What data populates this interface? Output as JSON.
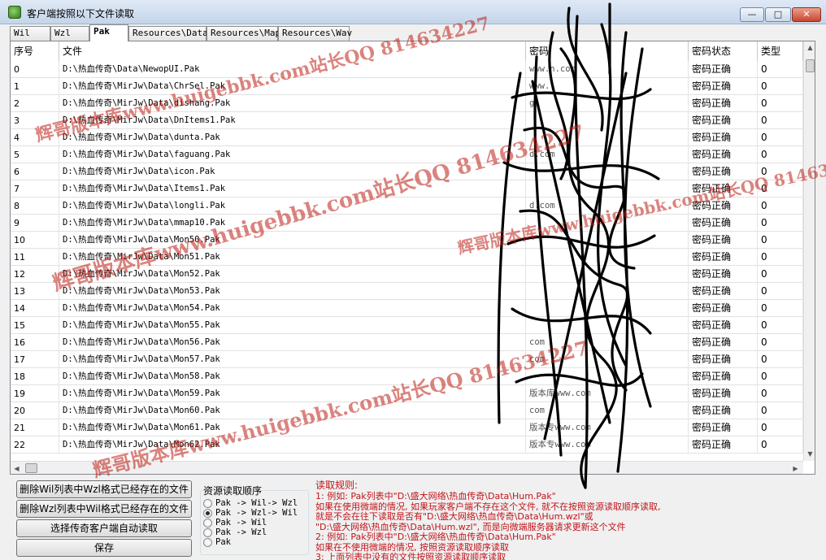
{
  "window": {
    "title": "客户端按照以下文件读取",
    "min_label": "—",
    "max_label": "□",
    "close_label": "✕"
  },
  "tabs": [
    {
      "label": "Wil"
    },
    {
      "label": "Wzl"
    },
    {
      "label": "Pak"
    },
    {
      "label": "Resources\\Data"
    },
    {
      "label": "Resources\\Map"
    },
    {
      "label": "Resources\\Wav"
    }
  ],
  "grid": {
    "columns": [
      "序号",
      "文件",
      "密码",
      "密码状态",
      "类型"
    ],
    "rows": [
      {
        "index": "0",
        "file": "D:\\热血传奇\\Data\\NewopUI.Pak",
        "password": "www.n.com",
        "status": "密码正确",
        "type": "0"
      },
      {
        "index": "1",
        "file": "D:\\热血传奇\\MirJw\\Data\\ChrSel.Pak",
        "password": "www.",
        "status": "密码正确",
        "type": "0"
      },
      {
        "index": "2",
        "file": "D:\\热血传奇\\MirJw\\Data\\dishang.Pak",
        "password": "g",
        "status": "密码正确",
        "type": "0"
      },
      {
        "index": "3",
        "file": "D:\\热血传奇\\MirJw\\Data\\DnItems1.Pak",
        "password": "",
        "status": "密码正确",
        "type": "0"
      },
      {
        "index": "4",
        "file": "D:\\热血传奇\\MirJw\\Data\\dunta.Pak",
        "password": "",
        "status": "密码正确",
        "type": "0"
      },
      {
        "index": "5",
        "file": "D:\\热血传奇\\MirJw\\Data\\faguang.Pak",
        "password": "d.com",
        "status": "密码正确",
        "type": "0"
      },
      {
        "index": "6",
        "file": "D:\\热血传奇\\MirJw\\Data\\icon.Pak",
        "password": "",
        "status": "密码正确",
        "type": "0"
      },
      {
        "index": "7",
        "file": "D:\\热血传奇\\MirJw\\Data\\Items1.Pak",
        "password": "",
        "status": "密码正确",
        "type": "0"
      },
      {
        "index": "8",
        "file": "D:\\热血传奇\\MirJw\\Data\\longli.Pak",
        "password": "d.com",
        "status": "密码正确",
        "type": "0"
      },
      {
        "index": "9",
        "file": "D:\\热血传奇\\MirJw\\Data\\mmap10.Pak",
        "password": "",
        "status": "密码正确",
        "type": "0"
      },
      {
        "index": "10",
        "file": "D:\\热血传奇\\MirJw\\Data\\Mon50.Pak",
        "password": "",
        "status": "密码正确",
        "type": "0"
      },
      {
        "index": "11",
        "file": "D:\\热血传奇\\MirJw\\Data\\Mon51.Pak",
        "password": "",
        "status": "密码正确",
        "type": "0"
      },
      {
        "index": "12",
        "file": "D:\\热血传奇\\MirJw\\Data\\Mon52.Pak",
        "password": "",
        "status": "密码正确",
        "type": "0"
      },
      {
        "index": "13",
        "file": "D:\\热血传奇\\MirJw\\Data\\Mon53.Pak",
        "password": "",
        "status": "密码正确",
        "type": "0"
      },
      {
        "index": "14",
        "file": "D:\\热血传奇\\MirJw\\Data\\Mon54.Pak",
        "password": "",
        "status": "密码正确",
        "type": "0"
      },
      {
        "index": "15",
        "file": "D:\\热血传奇\\MirJw\\Data\\Mon55.Pak",
        "password": "",
        "status": "密码正确",
        "type": "0"
      },
      {
        "index": "16",
        "file": "D:\\热血传奇\\MirJw\\Data\\Mon56.Pak",
        "password": "com",
        "status": "密码正确",
        "type": "0"
      },
      {
        "index": "17",
        "file": "D:\\热血传奇\\MirJw\\Data\\Mon57.Pak",
        "password": "com",
        "status": "密码正确",
        "type": "0"
      },
      {
        "index": "18",
        "file": "D:\\热血传奇\\MirJw\\Data\\Mon58.Pak",
        "password": "",
        "status": "密码正确",
        "type": "0"
      },
      {
        "index": "19",
        "file": "D:\\热血传奇\\MirJw\\Data\\Mon59.Pak",
        "password": "版本库www.com",
        "status": "密码正确",
        "type": "0"
      },
      {
        "index": "20",
        "file": "D:\\热血传奇\\MirJw\\Data\\Mon60.Pak",
        "password": "com",
        "status": "密码正确",
        "type": "0"
      },
      {
        "index": "21",
        "file": "D:\\热血传奇\\MirJw\\Data\\Mon61.Pak",
        "password": "版本专www.com",
        "status": "密码正确",
        "type": "0"
      },
      {
        "index": "22",
        "file": "D:\\热血传奇\\MirJw\\Data\\Mon62.Pak",
        "password": "版本专www.com",
        "status": "密码正确",
        "type": "0"
      }
    ]
  },
  "buttons": {
    "delete_wil": "删除Wil列表中Wzl格式已经存在的文件",
    "delete_wzl": "删除Wzl列表中Wil格式已经存在的文件",
    "auto_read": "选择传奇客户端自动读取",
    "save": "保存"
  },
  "resource_order": {
    "title": "资源读取顺序",
    "options": [
      {
        "label": "Pak -> Wil-> Wzl",
        "checked": false
      },
      {
        "label": "Pak -> Wzl-> Wil",
        "checked": true
      },
      {
        "label": "Pak -> Wil",
        "checked": false
      },
      {
        "label": "Pak -> Wzl",
        "checked": false
      },
      {
        "label": "Pak",
        "checked": false
      }
    ]
  },
  "rules": {
    "title": "读取规则:",
    "lines": [
      "1: 例如: Pak列表中\"D:\\盛大网络\\热血传奇\\Data\\Hum.Pak\"",
      "    如果在使用微端的情况, 如果玩家客户端不存在这个文件, 就不在按照资源读取顺序读取,",
      "    就是不会在往下读取是否有\"D:\\盛大网络\\热血传奇\\Data\\Hum.wzl\"或",
      "    \"D:\\盛大网络\\热血传奇\\Data\\Hum.wzl\", 而是向微端服务器请求更新这个文件",
      "2: 例如: Pak列表中\"D:\\盛大网络\\热血传奇\\Data\\Hum.Pak\"",
      "    如果在不使用微端的情况, 按照资源读取顺序读取",
      "3: 上面列表中没有的文件按照资源读取顺序读取"
    ]
  },
  "watermarks": [
    "辉哥版本库www.huigebbk.com站长QQ 814634227"
  ],
  "colors": {
    "watermark": "#be1e14",
    "rules_text": "#c0141a",
    "titlebar": "#c4d5ea"
  }
}
